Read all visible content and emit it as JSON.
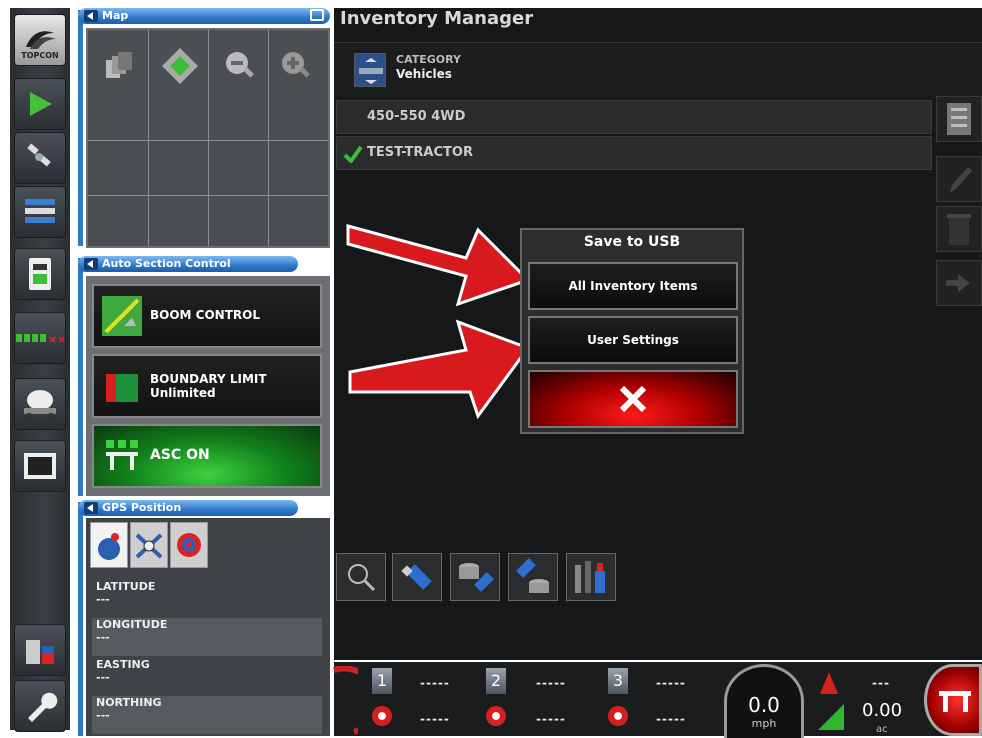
{
  "app": {
    "logo_text": "TOPCON",
    "title": "Inventory Manager"
  },
  "rail": {
    "items": [
      {
        "icon": "topcon-logo-icon"
      },
      {
        "icon": "play-icon"
      },
      {
        "icon": "satellite-icon"
      },
      {
        "icon": "bars-icon"
      },
      {
        "icon": "tablet-icon"
      },
      {
        "icon": "section-status-icon"
      },
      {
        "icon": "sprayer-icon"
      },
      {
        "icon": "film-icon"
      },
      {
        "icon": "usb-bin-icon"
      },
      {
        "icon": "wrench-icon"
      }
    ]
  },
  "map_panel": {
    "header": "Map"
  },
  "asc_panel": {
    "header": "Auto Section Control",
    "boom_control": "BOOM CONTROL",
    "boundary_limit": "BOUNDARY LIMIT",
    "boundary_value": "Unlimited",
    "asc_on": "ASC ON"
  },
  "gps_panel": {
    "header": "GPS Position",
    "rows": [
      {
        "label": "LATITUDE",
        "value": "---"
      },
      {
        "label": "LONGITUDE",
        "value": "---"
      },
      {
        "label": "EASTING",
        "value": "---"
      },
      {
        "label": "NORTHING",
        "value": "---"
      }
    ]
  },
  "inventory": {
    "category_label": "CATEGORY",
    "category_value": "Vehicles",
    "items": [
      {
        "name": "450-550 4WD",
        "checked": false
      },
      {
        "name": "TEST-TRACTOR",
        "checked": true
      }
    ]
  },
  "dialog": {
    "title": "Save to USB",
    "option_all": "All Inventory Items",
    "option_user": "User Settings"
  },
  "status_bar": {
    "sections": [
      {
        "number": "1",
        "top": "-----",
        "bottom": "-----"
      },
      {
        "number": "2",
        "top": "-----",
        "bottom": "-----"
      },
      {
        "number": "3",
        "top": "-----",
        "bottom": "-----"
      }
    ],
    "speed_value": "0.0",
    "speed_unit": "mph",
    "heading_value": "---",
    "area_value": "0.00",
    "area_unit": "ac"
  },
  "colors": {
    "accent_blue": "#2f79c9",
    "arrow_red": "#d81a1f",
    "cancel_red": "#e01010"
  }
}
